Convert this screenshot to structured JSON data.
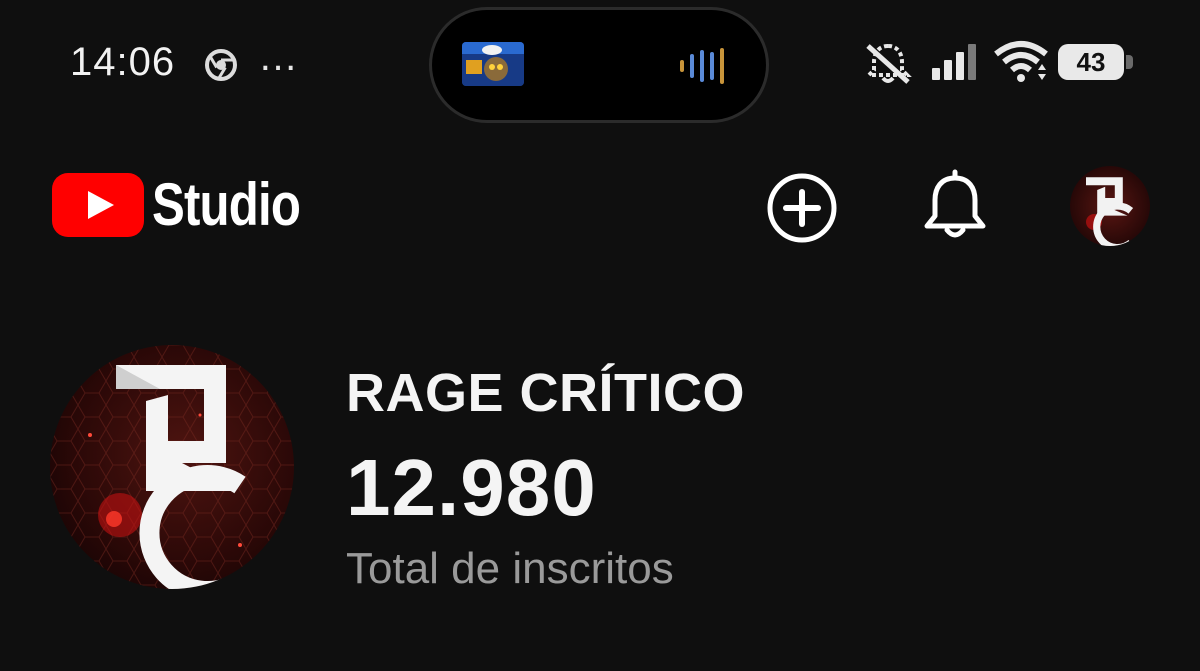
{
  "status_bar": {
    "time": "14:06",
    "more": "…",
    "battery": "43",
    "icons": [
      "chrome-icon",
      "media-island",
      "mute-icon",
      "signal-icon",
      "wifi-icon",
      "battery-icon"
    ]
  },
  "header": {
    "app_name": "Studio",
    "actions": [
      "create-icon",
      "notifications-icon",
      "account-avatar"
    ],
    "brand_color": "#ff0000"
  },
  "channel": {
    "name": "RAGE CRÍTICO",
    "subscriber_count": "12.980",
    "subscriber_label": "Total de inscritos"
  }
}
